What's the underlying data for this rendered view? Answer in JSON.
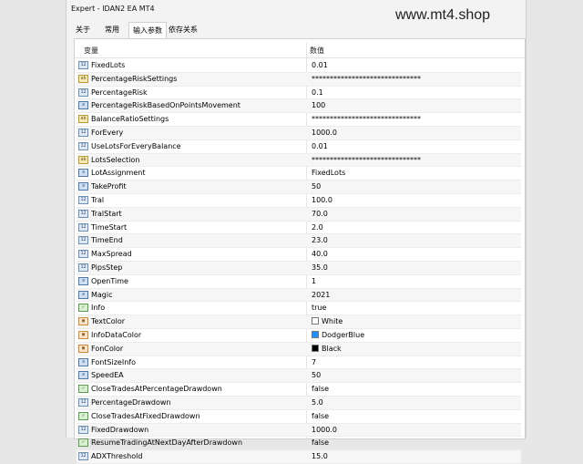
{
  "window": {
    "title": "Expert - IDAN2 EA MT4"
  },
  "watermark": "www.mt4.shop",
  "tabs": [
    {
      "label": "关于",
      "active": false
    },
    {
      "label": "常用",
      "active": false
    },
    {
      "label": "输入参数",
      "active": true
    },
    {
      "label": "依存关系",
      "active": false
    }
  ],
  "table": {
    "headers": {
      "variable": "变量",
      "value": "数值"
    },
    "rows": [
      {
        "icon": "num-icon",
        "name": "FixedLots",
        "value": "0.01"
      },
      {
        "icon": "text-icon",
        "name": "PercentageRiskSettings",
        "value": "******************************"
      },
      {
        "icon": "num-icon",
        "name": "PercentageRisk",
        "value": "0.1"
      },
      {
        "icon": "enum-icon",
        "name": "PercentageRiskBasedOnPointsMovement",
        "value": "100"
      },
      {
        "icon": "text-icon",
        "name": "BalanceRatioSettings",
        "value": "******************************"
      },
      {
        "icon": "num-icon",
        "name": "ForEvery",
        "value": "1000.0"
      },
      {
        "icon": "num-icon",
        "name": "UseLotsForEveryBalance",
        "value": "0.01"
      },
      {
        "icon": "text-icon",
        "name": "LotsSelection",
        "value": "******************************"
      },
      {
        "icon": "enum-icon",
        "name": "LotAssignment",
        "value": "FixedLots"
      },
      {
        "icon": "enum-icon",
        "name": "TakeProfit",
        "value": "50"
      },
      {
        "icon": "num-icon",
        "name": "Tral",
        "value": "100.0"
      },
      {
        "icon": "num-icon",
        "name": "TralStart",
        "value": "70.0"
      },
      {
        "icon": "num-icon",
        "name": "TimeStart",
        "value": "2.0"
      },
      {
        "icon": "num-icon",
        "name": "TimeEnd",
        "value": "23.0"
      },
      {
        "icon": "num-icon",
        "name": "MaxSpread",
        "value": "40.0"
      },
      {
        "icon": "num-icon",
        "name": "PipsStep",
        "value": "35.0"
      },
      {
        "icon": "enum-icon",
        "name": "OpenTime",
        "value": "1"
      },
      {
        "icon": "enum-icon",
        "name": "Magic",
        "value": "2021"
      },
      {
        "icon": "bool-icon",
        "name": "Info",
        "value": "true"
      },
      {
        "icon": "color-icon",
        "name": "TextColor",
        "value": "White",
        "swatch": "#ffffff"
      },
      {
        "icon": "color-icon",
        "name": "InfoDataColor",
        "value": "DodgerBlue",
        "swatch": "#1e90ff"
      },
      {
        "icon": "color-icon",
        "name": "FonColor",
        "value": "Black",
        "swatch": "#000000"
      },
      {
        "icon": "enum-icon",
        "name": "FontSizeInfo",
        "value": "7"
      },
      {
        "icon": "enum-icon",
        "name": "SpeedEA",
        "value": "50"
      },
      {
        "icon": "bool-icon",
        "name": "CloseTradesAtPercentageDrawdown",
        "value": "false"
      },
      {
        "icon": "num-icon",
        "name": "PercentageDrawdown",
        "value": "5.0"
      },
      {
        "icon": "bool-icon",
        "name": "CloseTradesAtFixedDrawdown",
        "value": "false"
      },
      {
        "icon": "num-icon",
        "name": "FixedDrawdown",
        "value": "1000.0"
      },
      {
        "icon": "bool-icon",
        "name": "ResumeTradingAtNextDayAfterDrawdown",
        "value": "false"
      },
      {
        "icon": "num-icon",
        "name": "ADXThreshold",
        "value": "15.0"
      }
    ]
  }
}
